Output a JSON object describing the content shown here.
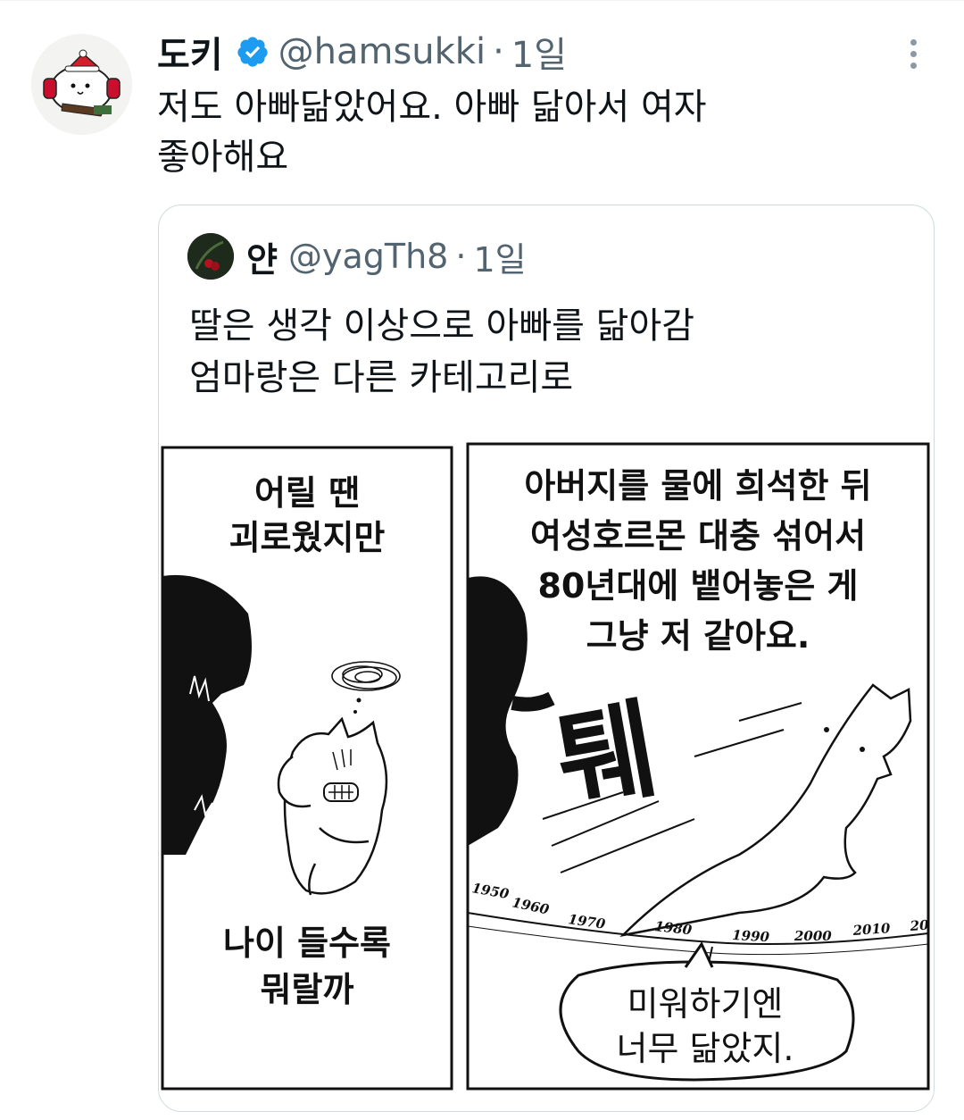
{
  "tweet": {
    "display_name": "도키",
    "handle": "@hamsukki",
    "separator": "·",
    "time": "1일",
    "text_lines": [
      "저도 아빠닮았어요. 아빠 닮아서 여자",
      "좋아해요"
    ]
  },
  "quoted_tweet": {
    "display_name": "얀",
    "handle": "@yagTh8",
    "separator": "·",
    "time": "1일",
    "text_lines": [
      "딸은 생각 이상으로 아빠를 닮아감",
      "엄마랑은 다른 카테고리로"
    ]
  },
  "comic": {
    "left_panel": {
      "top_caption": [
        "어릴 땐",
        "괴로웠지만"
      ],
      "bottom_caption": [
        "나이 들수록",
        "뭐랄까"
      ]
    },
    "right_panel": {
      "caption": [
        "아버지를 물에 희석한 뒤",
        "여성호르몬 대충 섞어서",
        "80년대에 뱉어놓은 게",
        "그냥 저 같아요."
      ],
      "sound_effect": "퉤",
      "timeline_years": [
        "1950",
        "1960",
        "1970",
        "1980",
        "1990",
        "2000",
        "2010",
        "20"
      ],
      "speech_bubble": [
        "미워하기엔",
        "너무 닮았지."
      ]
    }
  },
  "colors": {
    "verified_blue": "#1d9bf0",
    "secondary_text": "#536471",
    "border": "#cfd9de"
  }
}
